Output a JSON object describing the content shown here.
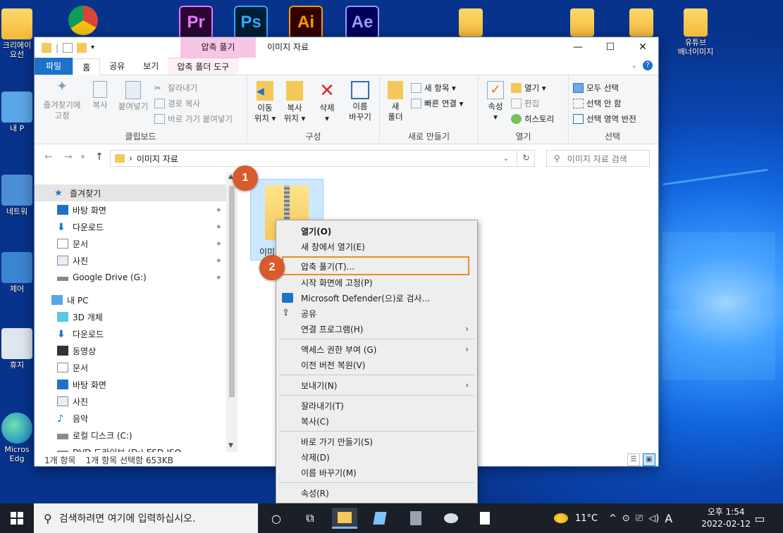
{
  "desktop": {
    "left_icons": [
      {
        "label": "크리에이\n요선"
      },
      {
        "label": "내 P"
      },
      {
        "label": "네트워"
      },
      {
        "label": "제어"
      },
      {
        "label": "휴지"
      },
      {
        "label": "Micros\nEdg"
      }
    ],
    "right_icons": [
      {
        "label": "유튜브\n배너이미지"
      }
    ],
    "app_tiles": [
      "Pr",
      "Ps",
      "Ai",
      "Ae"
    ]
  },
  "window": {
    "title": "이미지 자료",
    "context_tab_header": "압축 풀기",
    "tabs": {
      "file": "파일",
      "home": "홈",
      "share": "공유",
      "view": "보기",
      "compressed": "압축 폴더 도구"
    },
    "controls": {
      "minimize": "—",
      "maximize": "☐",
      "close": "✕"
    },
    "ribbon": {
      "clipboard": {
        "label": "클립보드",
        "pin": "즐겨찾기에\n고정",
        "copy": "복사",
        "paste": "붙여넣기",
        "cut": "잘라내기",
        "copy_path": "경로 복사",
        "paste_shortcut": "바로 가기 붙여넣기"
      },
      "organize": {
        "label": "구성",
        "move_to": "이동\n위치 ▾",
        "copy_to": "복사\n위치 ▾",
        "delete": "삭제\n▾",
        "rename": "이름\n바꾸기"
      },
      "new": {
        "label": "새로 만들기",
        "new_folder": "새\n폴더",
        "new_item": "새 항목 ▾",
        "easy_access": "빠른 연결 ▾"
      },
      "open": {
        "label": "열기",
        "properties": "속성\n▾",
        "open": "열기 ▾",
        "edit": "편집",
        "history": "히스토리"
      },
      "select": {
        "label": "선택",
        "select_all": "모두 선택",
        "select_none": "선택 안 함",
        "invert": "선택 영역 반전"
      }
    },
    "address": {
      "path": "이미지 자료",
      "search_placeholder": "이미지 자료 검색"
    },
    "nav": {
      "quick_access": "즐겨찾기",
      "quick_items": [
        "바탕 화면",
        "다운로드",
        "문서",
        "사진",
        "Google Drive (G:)"
      ],
      "this_pc": "내 PC",
      "pc_items": [
        "3D 개체",
        "다운로드",
        "동영상",
        "문서",
        "바탕 화면",
        "사진",
        "음악",
        "로컬 디스크 (C:)",
        "DVD 드라이브 (D:) ESD-ISO"
      ]
    },
    "file": {
      "name": "이미"
    },
    "status": {
      "count": "1개 항목",
      "selected": "1개 항목 선택함 653KB"
    }
  },
  "context_menu": {
    "items": [
      {
        "label": "열기(O)",
        "bold": true
      },
      {
        "label": "새 창에서 열기(E)"
      },
      {
        "label": "압축 풀기(T)..."
      },
      {
        "label": "시작 화면에 고정(P)"
      },
      {
        "label": "Microsoft Defender(으)로 검사..."
      },
      {
        "label": "공유"
      },
      {
        "label": "연결 프로그램(H)"
      },
      {
        "label": "액세스 권한 부여 (G)"
      },
      {
        "label": "이전 버전 복원(V)"
      },
      {
        "label": "보내기(N)"
      },
      {
        "label": "잘라내기(T)"
      },
      {
        "label": "복사(C)"
      },
      {
        "label": "바로 가기 만들기(S)"
      },
      {
        "label": "삭제(D)"
      },
      {
        "label": "이름 바꾸기(M)"
      },
      {
        "label": "속성(R)"
      }
    ]
  },
  "badges": {
    "one": "1",
    "two": "2"
  },
  "taskbar": {
    "search_placeholder": "검색하려면 여기에 입력하십시오.",
    "weather": "11°C",
    "ime": "A",
    "time": "오후 1:54",
    "date": "2022-02-12"
  },
  "colors": {
    "accent": "#1a73c9",
    "highlight": "#f08a24",
    "badge": "#d95a2b",
    "context_tab": "#f7c6e4"
  }
}
